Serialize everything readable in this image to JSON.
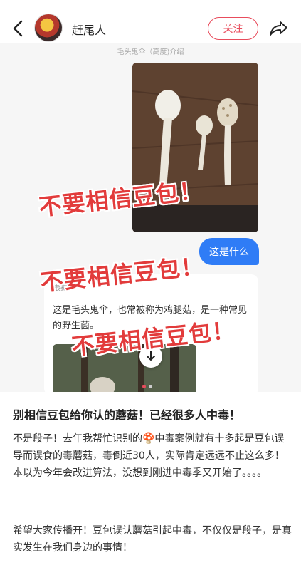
{
  "header": {
    "author_name": "赶尾人",
    "follow_label": "关注"
  },
  "carousel": {
    "top_caption": "毛头鬼伞（高度)介绍",
    "user_bubble": "这是什么",
    "reply_text": "这是毛头鬼伞，也常被称为鸡腿菇，是一种常见的野生菌。",
    "reply_header": "根据",
    "stamp_text": "不要相信豆包！",
    "dots_count": 2,
    "active_dot": 0
  },
  "post": {
    "title": "别相信豆包给你认的蘑菇！已经很多人中毒！",
    "paragraph1": "不是段子！去年我帮忙识别的🍄中毒案例就有十多起是豆包误导而误食的毒蘑菇，毒倒近30人，实际肯定远远不止这么多！本以为今年会改进算法，没想到刚进中毒季又开始了。。。。",
    "paragraph2": "希望大家传播开！豆包误认蘑菇引起中毒，不仅仅是段子，是真实发生在我们身边的事情！"
  },
  "colors": {
    "accent": "#e84c5c",
    "bubble": "#2f7cf6",
    "stamp": "#e23b3b"
  },
  "icons": {
    "back": "chevron-left-icon",
    "share": "share-arrow-icon",
    "download": "download-arrow-icon"
  }
}
